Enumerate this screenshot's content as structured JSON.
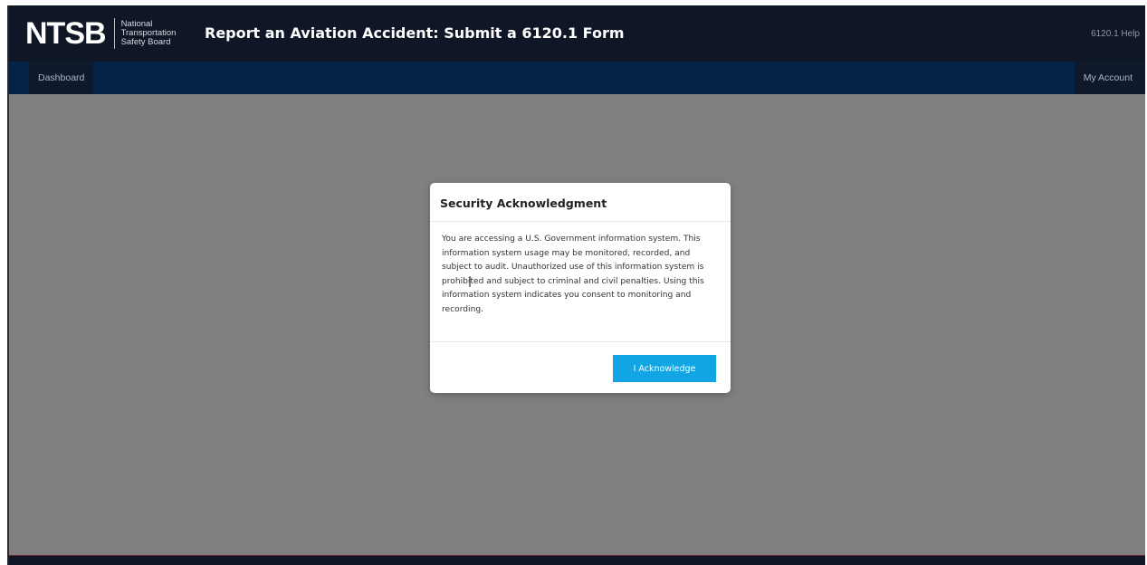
{
  "header": {
    "logo_text": "NTSB",
    "agency_lines": [
      "National",
      "Transportation",
      "Safety Board"
    ],
    "title": "Report an Aviation Accident: Submit a 6120.1 Form",
    "help_link": "6120.1 Help"
  },
  "nav": {
    "dashboard": "Dashboard",
    "account": "My Account"
  },
  "modal": {
    "title": "Security Acknowledgment",
    "body_lines": [
      "You are accessing a U.S. Government information system. This",
      "information system usage may be monitored, recorded, and",
      "subject to audit. Unauthorized use of this information system is",
      "prohibited and subject to criminal and civil penalties. Using this",
      "information system indicates you consent to monitoring and",
      "recording."
    ],
    "button_label": "I Acknowledge",
    "button_color": "#12a5e4"
  },
  "colors": {
    "header_bg": "#0f1626",
    "nav_bg": "#042447",
    "overlay": "#808080"
  }
}
